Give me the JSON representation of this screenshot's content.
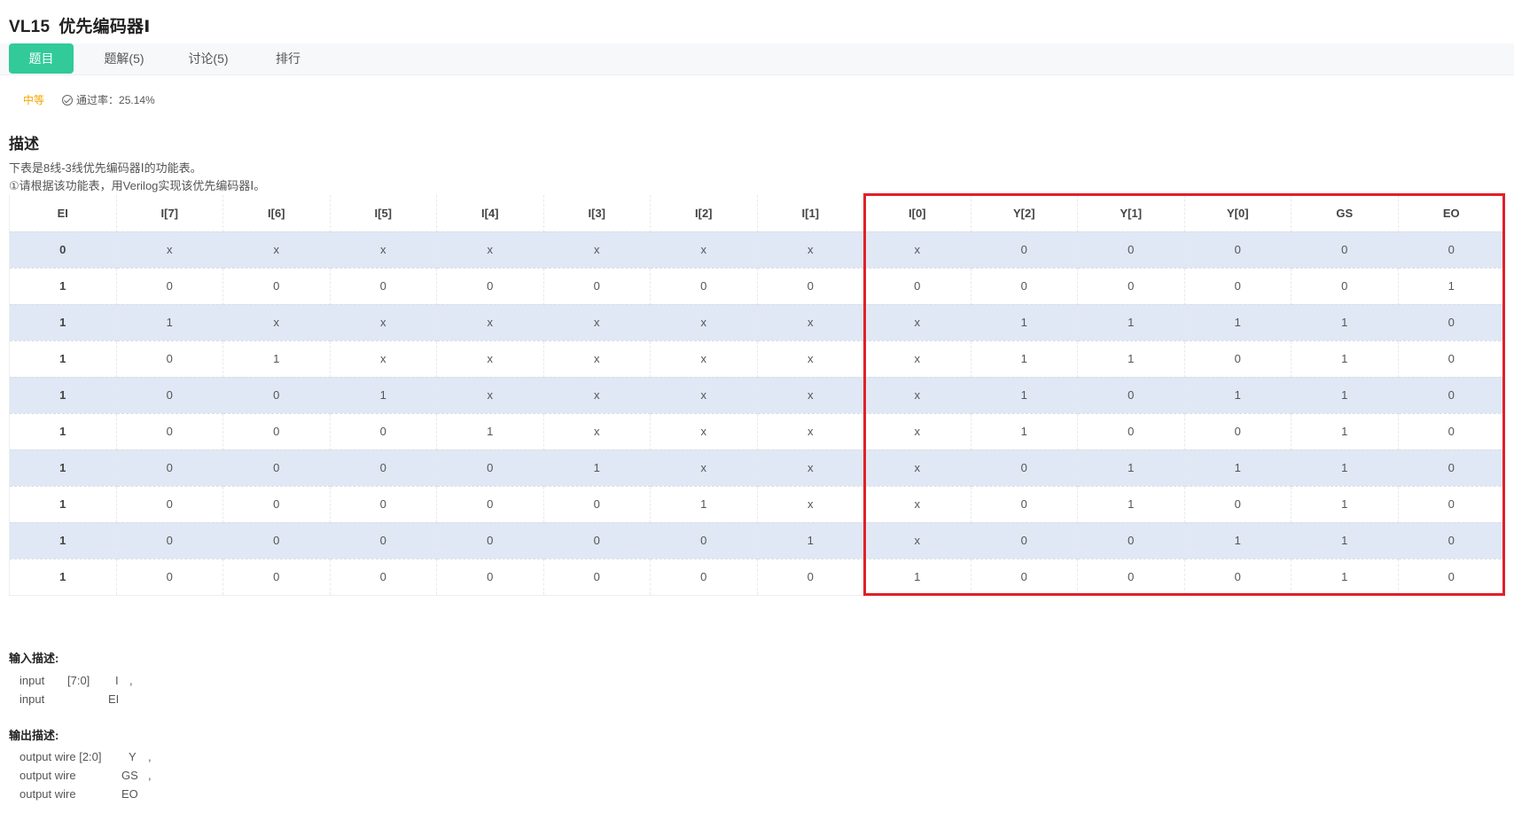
{
  "problem": {
    "code": "VL15",
    "name": "优先编码器Ⅰ"
  },
  "tabs": [
    {
      "label": "题目",
      "active": true
    },
    {
      "label": "题解(5)",
      "active": false
    },
    {
      "label": "讨论(5)",
      "active": false
    },
    {
      "label": "排行",
      "active": false
    }
  ],
  "meta": {
    "difficulty": "中等",
    "pass_rate": "通过率：25.14%"
  },
  "description": {
    "heading": "描述",
    "line1": "下表是8线-3线优先编码器Ⅰ的功能表。",
    "line2": "①请根据该功能表，用Verilog实现该优先编码器Ⅰ。"
  },
  "table": {
    "headers": [
      "EI",
      "I[7]",
      "I[6]",
      "I[5]",
      "I[4]",
      "I[3]",
      "I[2]",
      "I[1]",
      "I[0]",
      "Y[2]",
      "Y[1]",
      "Y[0]",
      "GS",
      "EO"
    ],
    "rows": [
      [
        "0",
        "x",
        "x",
        "x",
        "x",
        "x",
        "x",
        "x",
        "x",
        "0",
        "0",
        "0",
        "0",
        "0"
      ],
      [
        "1",
        "0",
        "0",
        "0",
        "0",
        "0",
        "0",
        "0",
        "0",
        "0",
        "0",
        "0",
        "0",
        "1"
      ],
      [
        "1",
        "1",
        "x",
        "x",
        "x",
        "x",
        "x",
        "x",
        "x",
        "1",
        "1",
        "1",
        "1",
        "0"
      ],
      [
        "1",
        "0",
        "1",
        "x",
        "x",
        "x",
        "x",
        "x",
        "x",
        "1",
        "1",
        "0",
        "1",
        "0"
      ],
      [
        "1",
        "0",
        "0",
        "1",
        "x",
        "x",
        "x",
        "x",
        "x",
        "1",
        "0",
        "1",
        "1",
        "0"
      ],
      [
        "1",
        "0",
        "0",
        "0",
        "1",
        "x",
        "x",
        "x",
        "x",
        "1",
        "0",
        "0",
        "1",
        "0"
      ],
      [
        "1",
        "0",
        "0",
        "0",
        "0",
        "1",
        "x",
        "x",
        "x",
        "0",
        "1",
        "1",
        "1",
        "0"
      ],
      [
        "1",
        "0",
        "0",
        "0",
        "0",
        "0",
        "1",
        "x",
        "x",
        "0",
        "1",
        "0",
        "1",
        "0"
      ],
      [
        "1",
        "0",
        "0",
        "0",
        "0",
        "0",
        "0",
        "1",
        "x",
        "0",
        "0",
        "1",
        "1",
        "0"
      ],
      [
        "1",
        "0",
        "0",
        "0",
        "0",
        "0",
        "0",
        "0",
        "1",
        "0",
        "0",
        "0",
        "1",
        "0"
      ]
    ]
  },
  "input": {
    "heading": "输入描述:",
    "rows": [
      [
        "input",
        "[7:0]",
        "I",
        ","
      ],
      [
        "input",
        "",
        "EI",
        ""
      ]
    ]
  },
  "output": {
    "heading": "输出描述:",
    "rows": [
      [
        "output wire [2:0]",
        "Y",
        ","
      ],
      [
        "output wire",
        "GS",
        ","
      ],
      [
        "output wire",
        "EO",
        ""
      ]
    ]
  },
  "colors": {
    "accent": "#32ca99",
    "difficulty": "#f5a500",
    "highlight": "#e0202a",
    "stripe": "#dfe8f4"
  }
}
